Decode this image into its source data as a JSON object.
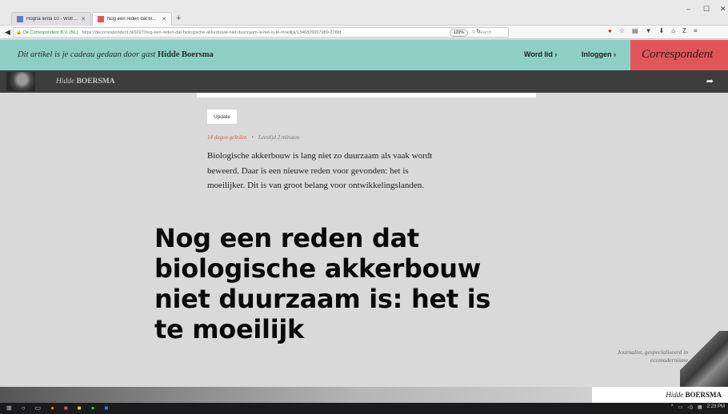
{
  "browser": {
    "tabs": [
      {
        "title": "Hogna lenta 10 - Wolf spi...",
        "favicon_color": "#5b7fbf"
      },
      {
        "title": "Nog een reden dat biologi...",
        "favicon_color": "#e15759"
      }
    ],
    "url": {
      "site_identity": "De Correspondent B.V. (NL)",
      "address": "https://decorrespondent.nl/6027/nog-een-reden-dat-biologische-akkerbouw-niet-duurzaam-is-het-is-te-moeilijk/134682600798​9-278bt",
      "zoom": "120%",
      "search_placeholder": "Search"
    }
  },
  "site": {
    "gift_prefix": "Dit artikel is je cadeau gedaan door gast ",
    "gift_name": "Hidde Boersma",
    "word_lid": "Word lid  ›",
    "inloggen": "Inloggen  ›",
    "logo": "Correspondent",
    "accent": "#e15759",
    "teal": "#8ecfc5"
  },
  "author_bar": {
    "first_name": "Hidde",
    "last_name": "BOERSMA"
  },
  "article": {
    "update_label": "Update",
    "posted_ago": "14 dagen geleden",
    "read_time": "Leestijd 2 minuten",
    "lead": "Biologische akkerbouw is lang niet zo duurzaam als vaak wordt beweerd. Daar is een nieuwe reden voor gevonden: het is moeilijker. Dit is van groot belang voor ontwikkelingslanden.",
    "headline": "Nog een reden dat biologische akkerbouw niet duurzaam is: het is te moeilijk"
  },
  "sidebar": {
    "bio": "Journalist, gespecialiseerd in ecomodernisme",
    "first_name": "Hidde",
    "last_name": "BOERSMA"
  },
  "taskbar": {
    "clock": "2:23 PM"
  }
}
